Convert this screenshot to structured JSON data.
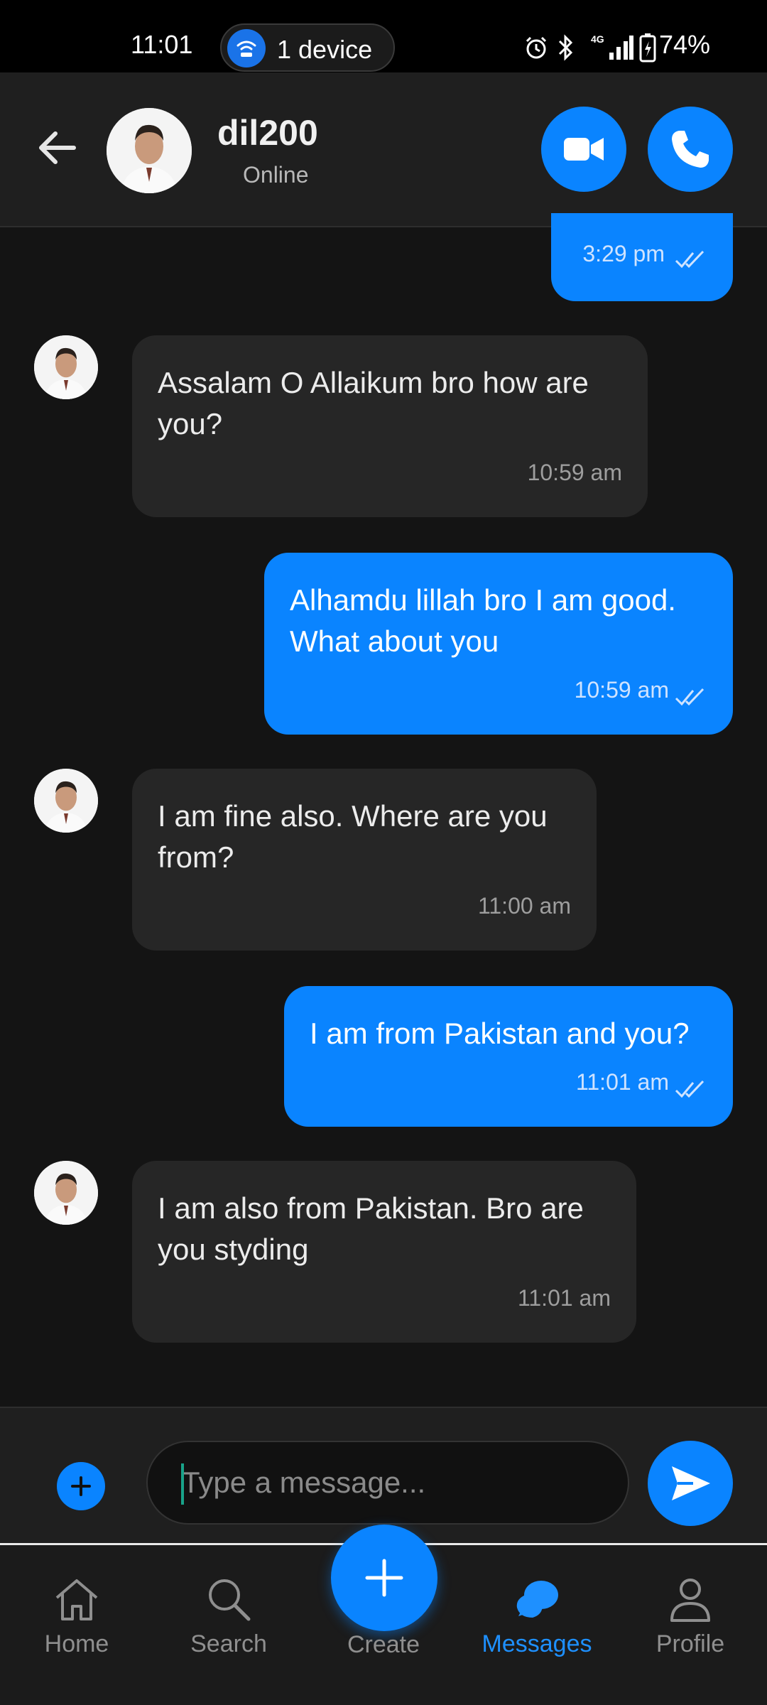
{
  "status_bar": {
    "time": "11:01",
    "device_label": "1 device",
    "battery": "74%",
    "icons": [
      "alarm-icon",
      "bluetooth-icon",
      "network-4g-icon",
      "signal-icon",
      "battery-charging-icon"
    ]
  },
  "header": {
    "contact_name": "dil200",
    "contact_status": "Online"
  },
  "messages": [
    {
      "direction": "outgoing",
      "text": "",
      "time": "3:29 pm",
      "read": true
    },
    {
      "direction": "incoming",
      "text": "Assalam O Allaikum bro how are you?",
      "time": "10:59 am"
    },
    {
      "direction": "outgoing",
      "text": "Alhamdu lillah bro I am good. What about you",
      "time": "10:59 am",
      "read": true
    },
    {
      "direction": "incoming",
      "text": "I am fine also. Where are you from?",
      "time": "11:00 am"
    },
    {
      "direction": "outgoing",
      "text": "I am from Pakistan and you?",
      "time": "11:01 am",
      "read": true
    },
    {
      "direction": "incoming",
      "text": "I am also from Pakistan. Bro are you styding",
      "time": "11:01 am"
    }
  ],
  "composer": {
    "placeholder": "Type a message...",
    "value": ""
  },
  "nav": {
    "home": "Home",
    "search": "Search",
    "create": "Create",
    "messages": "Messages",
    "profile": "Profile",
    "active": "messages"
  },
  "colors": {
    "accent": "#0a84ff",
    "background": "#141414",
    "incoming_bubble": "#262626"
  }
}
